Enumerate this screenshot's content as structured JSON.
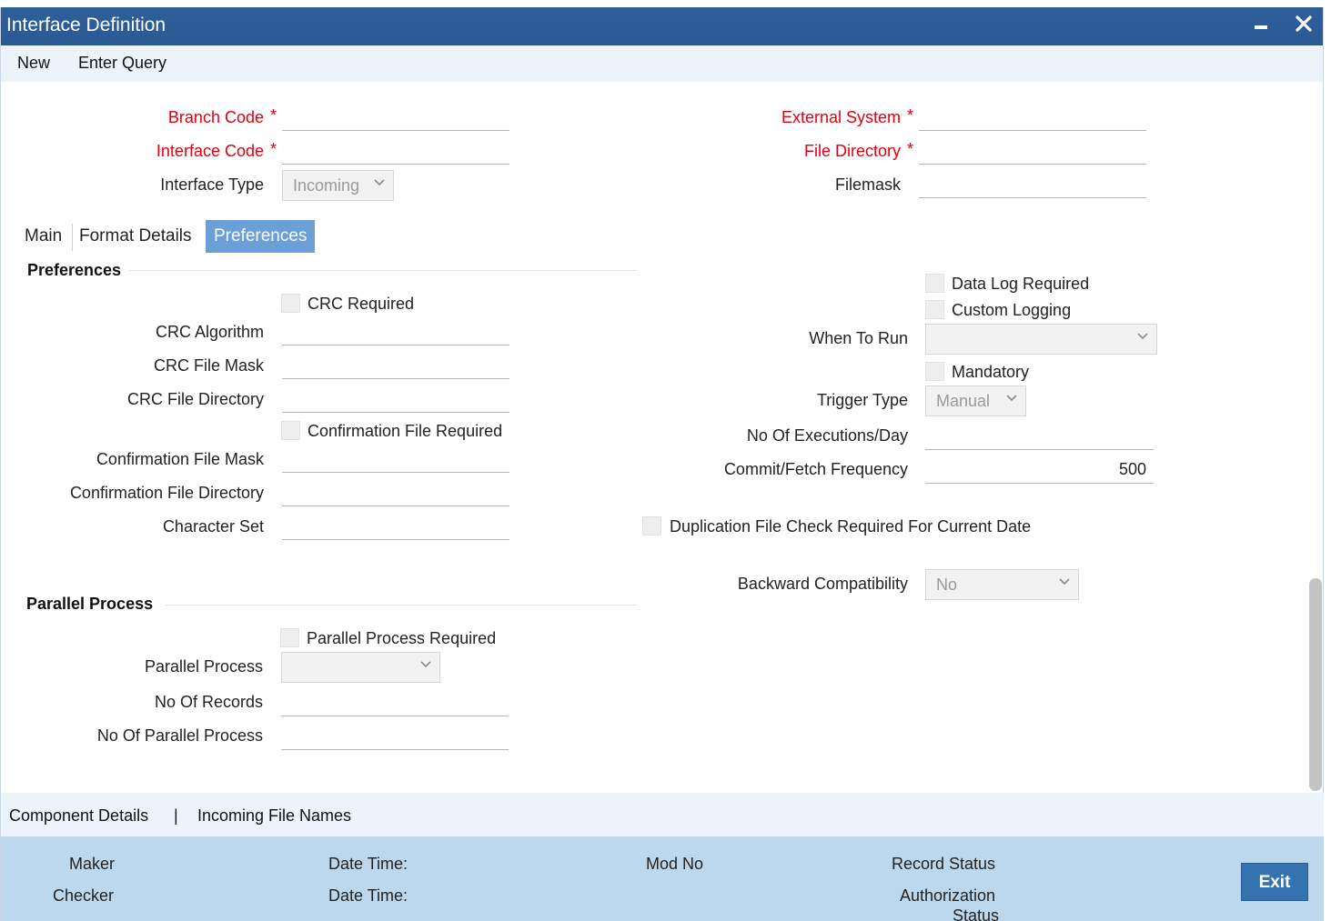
{
  "window": {
    "title": "Interface Definition",
    "minimize_icon": "minimize-icon",
    "close_icon": "close-icon"
  },
  "menu": {
    "new": "New",
    "enter_query": "Enter Query"
  },
  "header": {
    "branch_code_label": "Branch Code",
    "interface_code_label": "Interface Code",
    "interface_type_label": "Interface Type",
    "interface_type_value": "Incoming",
    "external_system_label": "External System",
    "file_directory_label": "File Directory",
    "filemask_label": "Filemask",
    "required_marker": "*"
  },
  "tabs": {
    "main": "Main",
    "format_details": "Format Details",
    "preferences": "Preferences",
    "active": "Preferences"
  },
  "preferences": {
    "section_title": "Preferences",
    "crc_required": "CRC Required",
    "crc_algorithm": "CRC Algorithm",
    "crc_file_mask": "CRC File Mask",
    "crc_file_directory": "CRC File Directory",
    "confirmation_file_required": "Confirmation File Required",
    "confirmation_file_mask": "Confirmation File Mask",
    "confirmation_file_directory": "Confirmation File Directory",
    "character_set": "Character Set",
    "data_log_required": "Data Log Required",
    "custom_logging": "Custom Logging",
    "when_to_run": "When To Run",
    "mandatory": "Mandatory",
    "trigger_type_label": "Trigger Type",
    "trigger_type_value": "Manual",
    "no_of_executions": "No Of Executions/Day",
    "commit_fetch_frequency_label": "Commit/Fetch Frequency",
    "commit_fetch_frequency_value": "500",
    "duplication_check": "Duplication File Check Required For Current Date",
    "backward_compatibility_label": "Backward Compatibility",
    "backward_compatibility_value": "No"
  },
  "parallel": {
    "section_title": "Parallel Process",
    "parallel_process_required": "Parallel Process Required",
    "parallel_process_label": "Parallel Process",
    "no_of_records": "No Of Records",
    "no_of_parallel_process": "No Of Parallel Process"
  },
  "bottom_links": {
    "component_details": "Component Details",
    "separator": "|",
    "incoming_file_names": "Incoming File Names"
  },
  "footer": {
    "maker": "Maker",
    "checker": "Checker",
    "date_time_1": "Date Time:",
    "date_time_2": "Date Time:",
    "mod_no": "Mod No",
    "record_status": "Record Status",
    "authorization": "Authorization",
    "status": "Status",
    "exit": "Exit"
  },
  "colors": {
    "titlebar": "#2f5f98",
    "required": "#e00012",
    "tab_active": "#6b9fd8",
    "footer": "#bdd8ec",
    "exit_button": "#3572b0"
  }
}
